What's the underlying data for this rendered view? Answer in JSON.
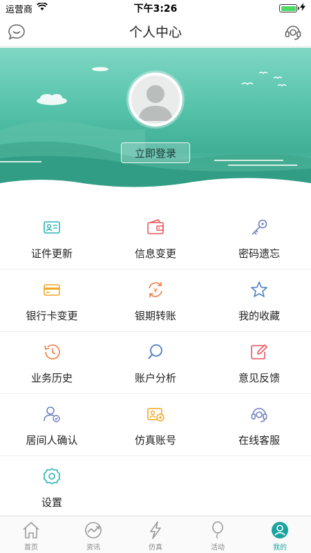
{
  "status_bar": {
    "carrier": "运营商",
    "time": "下午3:26",
    "battery_pct": 100
  },
  "nav": {
    "title": "个人中心",
    "left_icon": "chat-smile-icon",
    "right_icon": "headset-icon"
  },
  "banner": {
    "login_label": "立即登录"
  },
  "menu": {
    "items": [
      {
        "label": "证件更新",
        "icon": "id-card-icon",
        "color": "#29b4b1"
      },
      {
        "label": "信息变更",
        "icon": "wallet-icon",
        "color": "#e9545b"
      },
      {
        "label": "密码遗忘",
        "icon": "key-icon",
        "color": "#6e7fbf"
      },
      {
        "label": "银行卡变更",
        "icon": "bank-card-icon",
        "color": "#f5a623"
      },
      {
        "label": "银期转账",
        "icon": "yen-transfer-icon",
        "color": "#f07b3f"
      },
      {
        "label": "我的收藏",
        "icon": "star-icon",
        "color": "#4a7fc1"
      },
      {
        "label": "业务历史",
        "icon": "history-icon",
        "color": "#f07b3f"
      },
      {
        "label": "账户分析",
        "icon": "magnifier-icon",
        "color": "#4a7fc1"
      },
      {
        "label": "意见反馈",
        "icon": "edit-icon",
        "color": "#e9545b"
      },
      {
        "label": "居间人确认",
        "icon": "person-check-icon",
        "color": "#6e7fbf"
      },
      {
        "label": "仿真账号",
        "icon": "sim-account-icon",
        "color": "#f5a623"
      },
      {
        "label": "在线客服",
        "icon": "headset-icon",
        "color": "#6e7fbf"
      },
      {
        "label": "设置",
        "icon": "gear-icon",
        "color": "#29b4b1"
      }
    ]
  },
  "tabs": [
    {
      "label": "首页",
      "icon": "home-icon",
      "active": false
    },
    {
      "label": "资讯",
      "icon": "news-chart-icon",
      "active": false
    },
    {
      "label": "仿真",
      "icon": "lightning-icon",
      "active": false
    },
    {
      "label": "活动",
      "icon": "balloon-icon",
      "active": false
    },
    {
      "label": "我的",
      "icon": "profile-icon",
      "active": true
    }
  ],
  "colors": {
    "accent": "#1ba3a0",
    "banner_top": "#7fd7c4",
    "banner_bottom": "#3fae95"
  }
}
